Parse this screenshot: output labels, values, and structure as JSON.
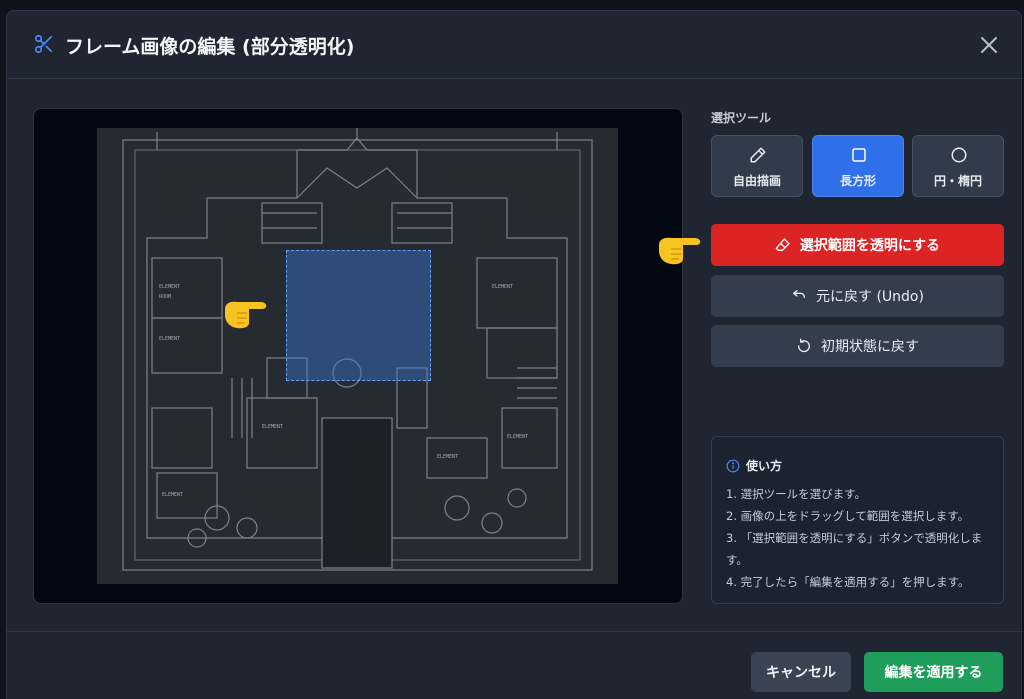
{
  "dialog": {
    "title": "フレーム画像の編集 (部分透明化)",
    "close_icon": "close-icon",
    "title_icon": "scissors-icon"
  },
  "tools": {
    "label": "選択ツール",
    "items": [
      {
        "label": "自由描画",
        "icon": "pencil-icon",
        "active": false
      },
      {
        "label": "長方形",
        "icon": "square-icon",
        "active": true
      },
      {
        "label": "円・楕円",
        "icon": "circle-icon",
        "active": false
      }
    ]
  },
  "actions": {
    "make_transparent": "選択範囲を透明にする",
    "undo": "元に戻す (Undo)",
    "reset": "初期状態に戻す"
  },
  "help": {
    "title": "使い方",
    "steps": [
      "1. 選択ツールを選びます。",
      "2. 画像の上をドラッグして範囲を選択します。",
      "3. 「選択範囲を透明にする」ボタンで透明化します。",
      "4. 完了したら「編集を適用する」を押します。"
    ]
  },
  "footer": {
    "cancel": "キャンセル",
    "apply": "編集を適用する"
  },
  "colors": {
    "accent_blue": "#2f6fe8",
    "danger_red": "#dc2424",
    "apply_green": "#1e9e5a",
    "dialog_bg": "#1f2632"
  }
}
